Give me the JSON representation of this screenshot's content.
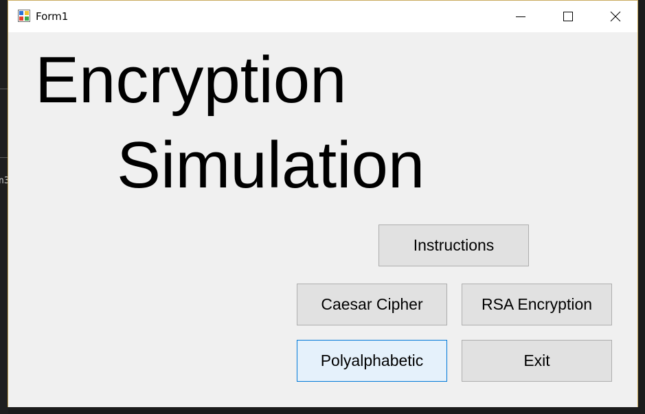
{
  "window": {
    "title": "Form1",
    "controls": {
      "minimize_icon": "minimize-icon",
      "maximize_icon": "maximize-icon",
      "close_icon": "close-icon"
    }
  },
  "heading": {
    "line1": "Encryption",
    "line2": "Simulation"
  },
  "buttons": {
    "instructions": "Instructions",
    "caesar": "Caesar Cipher",
    "rsa": "RSA Encryption",
    "poly": "Polyalphabetic",
    "exit": "Exit"
  },
  "background": {
    "glyph": "n3"
  },
  "colors": {
    "form_bg": "#f0f0f0",
    "button_bg": "#e1e1e1",
    "button_border": "#adadad",
    "focus_bg": "#e5f1fb",
    "focus_border": "#0078d7"
  }
}
